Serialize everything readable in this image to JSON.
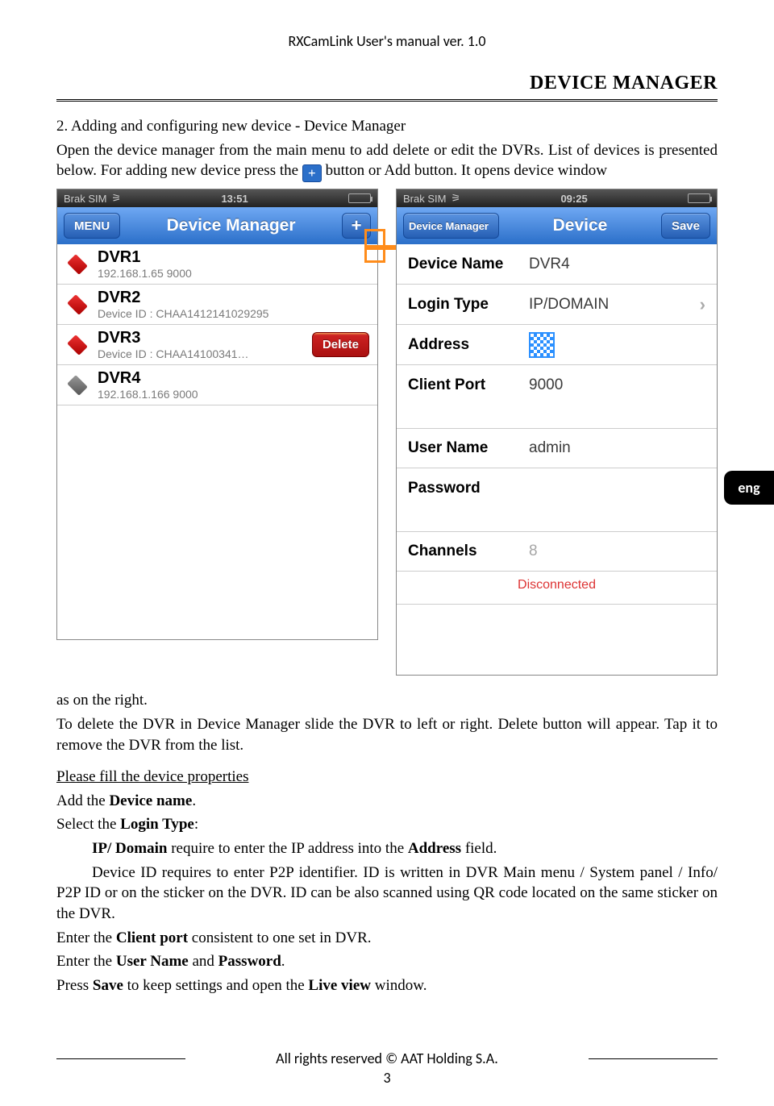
{
  "header": {
    "doc_title": "RXCamLink User's manual ver. 1.0"
  },
  "title": "DEVICE MANAGER",
  "lang_tab": "eng",
  "intro": {
    "heading": "2. Adding and configuring new device - Device Manager",
    "p1a": "Open the  device manager from the main menu to add delete or edit the DVRs. List of devices is presented below. For adding new device press the ",
    "plus": "+",
    "p1b": " button or Add button. It opens device window"
  },
  "screenshot_left": {
    "status": {
      "carrier": "Brak SIM",
      "time": "13:51"
    },
    "nav": {
      "menu": "MENU",
      "title": "Device Manager",
      "add": "+"
    },
    "rows": [
      {
        "name": "DVR1",
        "sub": "192.168.1.65  9000",
        "icon": "red"
      },
      {
        "name": "DVR2",
        "sub": "Device ID : CHAA1412141029295",
        "icon": "red"
      },
      {
        "name": "DVR3",
        "sub": "Device ID : CHAA14100341…",
        "icon": "red",
        "delete": "Delete"
      },
      {
        "name": "DVR4",
        "sub": "192.168.1.166  9000",
        "icon": "grey"
      }
    ]
  },
  "screenshot_right": {
    "status": {
      "carrier": "Brak SIM",
      "time": "09:25"
    },
    "nav": {
      "back": "Device Manager",
      "title": "Device",
      "save": "Save"
    },
    "fields": {
      "device_name_label": "Device Name",
      "device_name_val": "DVR4",
      "login_type_label": "Login Type",
      "login_type_val": "IP/DOMAIN",
      "address_label": "Address",
      "client_port_label": "Client Port",
      "client_port_val": "9000",
      "user_name_label": "User Name",
      "user_name_val": "admin",
      "password_label": "Password",
      "password_val": "",
      "channels_label": "Channels",
      "channels_val": "8",
      "status": "Disconnected"
    }
  },
  "body": {
    "p2": "as on the right.",
    "p3": "To delete the DVR in Device Manager slide the DVR to left or right. Delete button will appear. Tap it to remove the DVR from the list.",
    "p4": "Please fill the device properties",
    "p5a": "Add the ",
    "p5b": "Device name",
    "p5c": ".",
    "p6a": "Select the ",
    "p6b": "Login Type",
    "p6c": ":",
    "p7a": "IP/ Domain",
    "p7b": " require to enter the IP address into the ",
    "p7c": "Address",
    "p7d": " field.",
    "p8": "Device ID requires to enter P2P identifier. ID is written in DVR Main menu / System panel / Info/ P2P ID or on the sticker on the DVR. ID can be also scanned using QR code located on the same sticker on the DVR.",
    "p9a": "Enter the ",
    "p9b": "Client port",
    "p9c": " consistent to one set in DVR.",
    "p10a": "Enter the ",
    "p10b": "User Name",
    "p10c": " and ",
    "p10d": "Password",
    "p10e": ".",
    "p11a": "Press ",
    "p11b": "Save",
    "p11c": " to keep settings and open the ",
    "p11d": "Live view",
    "p11e": " window."
  },
  "footer": {
    "copyright": "All rights reserved © AAT Holding S.A.",
    "page": "3"
  }
}
